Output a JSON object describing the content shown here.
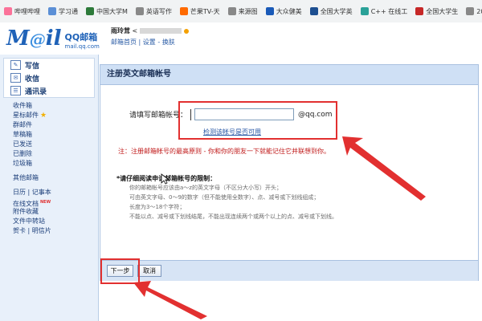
{
  "bookmarks": [
    {
      "label": "哔哩哔哩",
      "color": "#fb7299"
    },
    {
      "label": "学习通",
      "color": "#5b8fd6"
    },
    {
      "label": "中国大学M",
      "color": "#2d7a3a"
    },
    {
      "label": "英语写作",
      "color": "#888888"
    },
    {
      "label": "芒果TV-天",
      "color": "#ff6a00"
    },
    {
      "label": "来源图",
      "color": "#888888"
    },
    {
      "label": "大众健美",
      "color": "#1a5ab8"
    },
    {
      "label": "全国大学英",
      "color": "#1d4f91"
    },
    {
      "label": "C++ 在线工",
      "color": "#2aa198"
    },
    {
      "label": "全国大学生",
      "color": "#c62828"
    },
    {
      "label": "2020年全",
      "color": "#888888"
    }
  ],
  "header": {
    "logo_mark": "M",
    "logo_accent": "@",
    "logo_tail": "il",
    "logo_cn": "QQ邮箱",
    "logo_domain": "mail.qq.com",
    "user_name": "雨玲茸",
    "user_sep": "<",
    "links": "邮箱首页 | 设置 - 换肤"
  },
  "sidebar": {
    "actions": [
      {
        "icon": "pencil-icon",
        "glyph": "✎",
        "label": "写信"
      },
      {
        "icon": "inbox-icon",
        "glyph": "✉",
        "label": "收信"
      },
      {
        "icon": "contacts-icon",
        "glyph": "☰",
        "label": "通讯录"
      }
    ],
    "folders": [
      "收件箱",
      "星标邮件",
      "群邮件",
      "草稿箱",
      "已发送",
      "已删除",
      "垃圾箱"
    ],
    "other_label": "其他邮箱",
    "tools": [
      "日历 | 记事本",
      "在线文档",
      "附件收藏",
      "文件中转站",
      "贺卡 | 明信片"
    ],
    "new_badge": "NEW"
  },
  "main": {
    "title": "注册英文邮箱帐号",
    "label": "请填写邮箱帐号：",
    "input_value": "",
    "suffix": "@qq.com",
    "check_link": "检测该帐号是否可用",
    "note": "注：注册邮箱帐号的最高原则 - 你和你的朋友一下就能记住它并联想到你。",
    "rules_title": "*请仔细阅读申请邮箱帐号的限制：",
    "rules": [
      "你的邮箱帐号应该由a～z的英文字母（不区分大小写）开头；",
      "可由英文字母、0～9的数字（但不能使用全数字）、点、减号或下划线组成；",
      "长度为3～18个字符；",
      "不能以点、减号或下划线结尾，不能出现连续两个或两个以上的点、减号或下划线。"
    ],
    "next_label": "下一步",
    "cancel_label": "取消"
  },
  "colors": {
    "accent": "#1f62b8",
    "annotation": "#e23030",
    "note_red": "#c01a1a"
  }
}
